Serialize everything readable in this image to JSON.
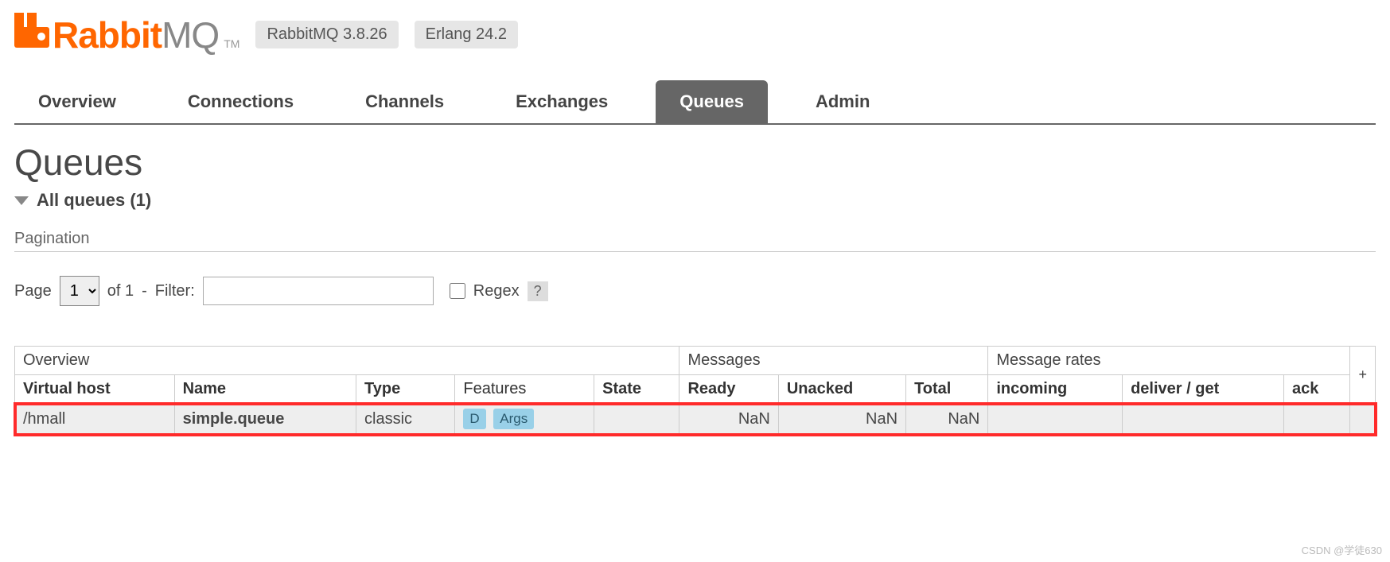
{
  "header": {
    "logo_text1": "Rabbit",
    "logo_text2": "MQ",
    "logo_tm": "TM",
    "version_rabbitmq": "RabbitMQ 3.8.26",
    "version_erlang": "Erlang 24.2"
  },
  "nav": {
    "tabs": [
      {
        "label": "Overview"
      },
      {
        "label": "Connections"
      },
      {
        "label": "Channels"
      },
      {
        "label": "Exchanges"
      },
      {
        "label": "Queues",
        "active": true
      },
      {
        "label": "Admin"
      }
    ]
  },
  "page": {
    "title": "Queues",
    "section": "All queues (1)",
    "pagination_label": "Pagination"
  },
  "filter": {
    "page_label": "Page",
    "page_value": "1",
    "of_label": "of 1",
    "dash": "-",
    "filter_label": "Filter:",
    "filter_value": "",
    "regex_label": "Regex",
    "help": "?"
  },
  "table": {
    "groups": {
      "overview": "Overview",
      "messages": "Messages",
      "rates": "Message rates",
      "plus": "+"
    },
    "columns": {
      "vhost": "Virtual host",
      "name": "Name",
      "type": "Type",
      "features": "Features",
      "state": "State",
      "ready": "Ready",
      "unacked": "Unacked",
      "total": "Total",
      "incoming": "incoming",
      "deliver_get": "deliver / get",
      "ack": "ack"
    },
    "rows": [
      {
        "vhost": "/hmall",
        "name": "simple.queue",
        "type": "classic",
        "features": [
          "D",
          "Args"
        ],
        "state": "",
        "ready": "NaN",
        "unacked": "NaN",
        "total": "NaN",
        "incoming": "",
        "deliver_get": "",
        "ack": ""
      }
    ]
  },
  "watermark": "CSDN @学徒630"
}
